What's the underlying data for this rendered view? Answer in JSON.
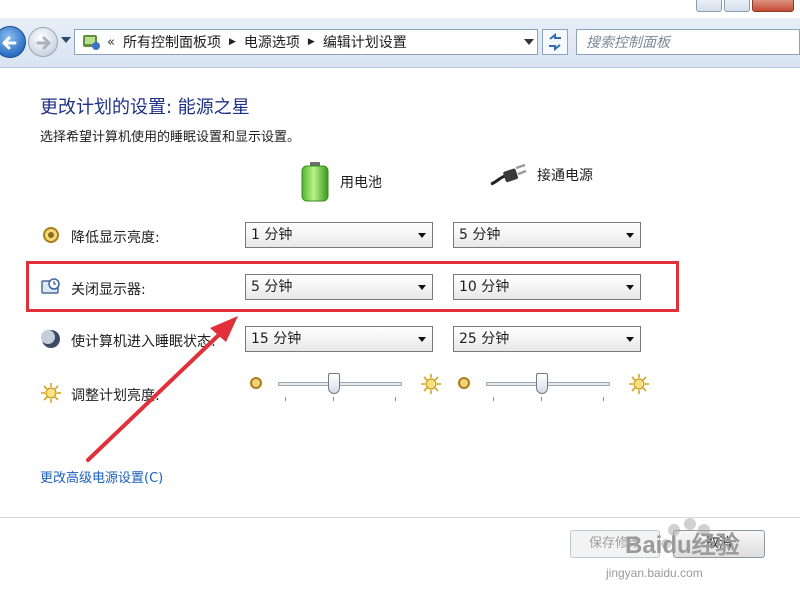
{
  "addressbar": {
    "breadcrumb_lead": "«",
    "crumbs": [
      "所有控制面板项",
      "电源选项",
      "编辑计划设置"
    ],
    "search_placeholder": "搜索控制面板"
  },
  "main": {
    "title": "更改计划的设置: 能源之星",
    "subtitle": "选择希望计算机使用的睡眠设置和显示设置。",
    "columns": {
      "battery": {
        "label": "用电池",
        "icon": "battery-icon"
      },
      "plugged": {
        "label": "接通电源",
        "icon": "power-plug-icon"
      }
    },
    "settings": [
      {
        "label": "降低显示亮度:",
        "icon": "dim-display-icon",
        "battery": "1 分钟",
        "plugged": "5 分钟"
      },
      {
        "label": "关闭显示器:",
        "icon": "monitor-icon",
        "battery": "5 分钟",
        "plugged": "10 分钟"
      },
      {
        "label": "使计算机进入睡眠状态:",
        "icon": "sleep-moon-icon",
        "battery": "15 分钟",
        "plugged": "25 分钟"
      }
    ],
    "brightness": {
      "label": "调整计划亮度:",
      "icon": "brightness-icon",
      "battery_level": 0.45,
      "plugged_level": 0.45
    },
    "advanced_link": "更改高级电源设置(C)"
  },
  "footer": {
    "save_label": "保存修改",
    "cancel_label": "取消"
  },
  "watermark": {
    "brand": "Baidu经验",
    "url": "jingyan.baidu.com"
  },
  "colors": {
    "title": "#1e3287",
    "link": "#1a5fbd",
    "highlight": "#e0313a"
  }
}
